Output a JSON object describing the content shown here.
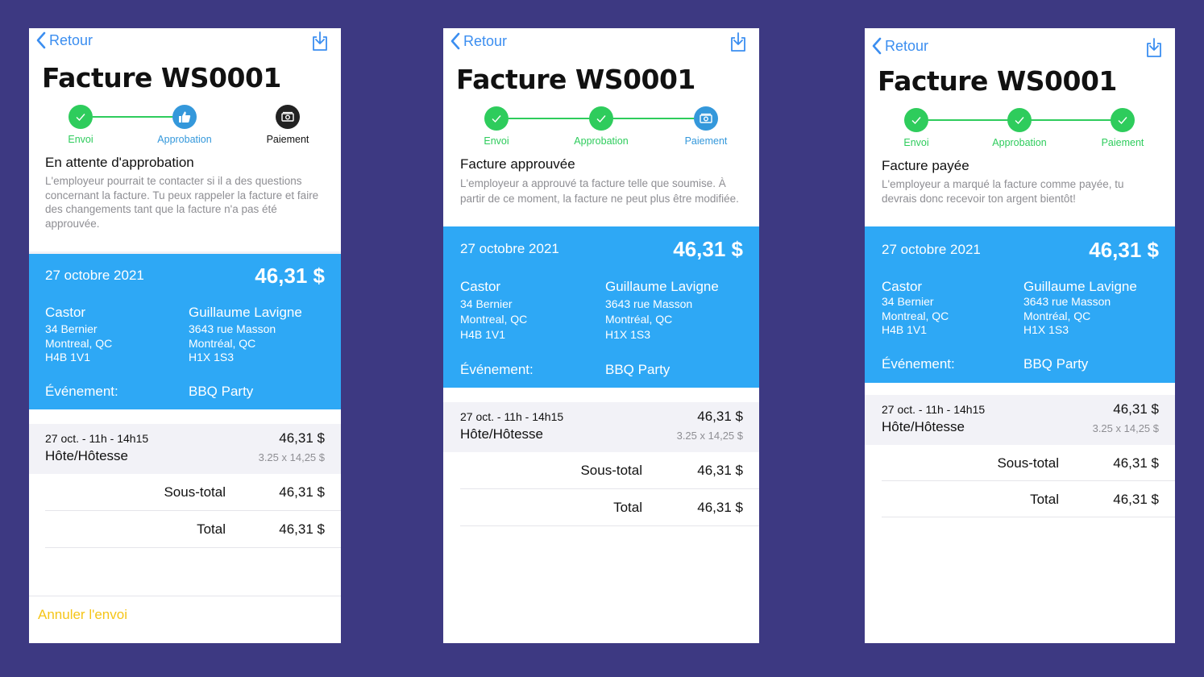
{
  "back_label": "Retour",
  "title": "Facture WS0001",
  "steps": [
    "Envoi",
    "Approbation",
    "Paiement"
  ],
  "colors": {
    "background": "#3d3982",
    "blue_block": "#2ea8f5",
    "green": "#2ecc5c",
    "blue": "#3498db",
    "cancel": "#f5c518"
  },
  "icons": {
    "back": "chevron-left-icon",
    "download": "download-icon",
    "check": "check-icon",
    "thumbs_up": "thumbs-up-icon",
    "money": "money-icon"
  },
  "invoice": {
    "date": "27 octobre 2021",
    "amount": "46,31 $",
    "sender": {
      "name": "Castor",
      "street": "34 Bernier",
      "city": "Montreal, QC",
      "postal": "H4B 1V1"
    },
    "recipient": {
      "name": "Guillaume Lavigne",
      "street": "3643 rue Masson",
      "city": "Montréal, QC",
      "postal": "H1X 1S3"
    },
    "event_label": "Événement:",
    "event_value": "BBQ Party",
    "item": {
      "date": "27 oct. - 11h - 14h15",
      "role": "Hôte/Hôtesse",
      "amount": "46,31 $",
      "calc": "3.25 x 14,25 $"
    },
    "subtotal_label": "Sous-total",
    "subtotal_value": "46,31 $",
    "total_label": "Total",
    "total_value": "46,31 $"
  },
  "screens": [
    {
      "status_title": "En attente d'approbation",
      "status_desc": "L'employeur pourrait te contacter si il a des questions concernant la facture. Tu peux rappeler la facture et faire des changements tant que la facture n'a pas été approuvée.",
      "cancel_label": "Annuler l'envoi"
    },
    {
      "status_title": "Facture approuvée",
      "status_desc": "L'employeur a approuvé ta facture telle que soumise. À partir de ce moment, la facture ne peut plus être modifiée."
    },
    {
      "status_title": "Facture payée",
      "status_desc": "L'employeur a marqué la facture comme payée, tu devrais donc recevoir ton argent bientôt!"
    }
  ]
}
